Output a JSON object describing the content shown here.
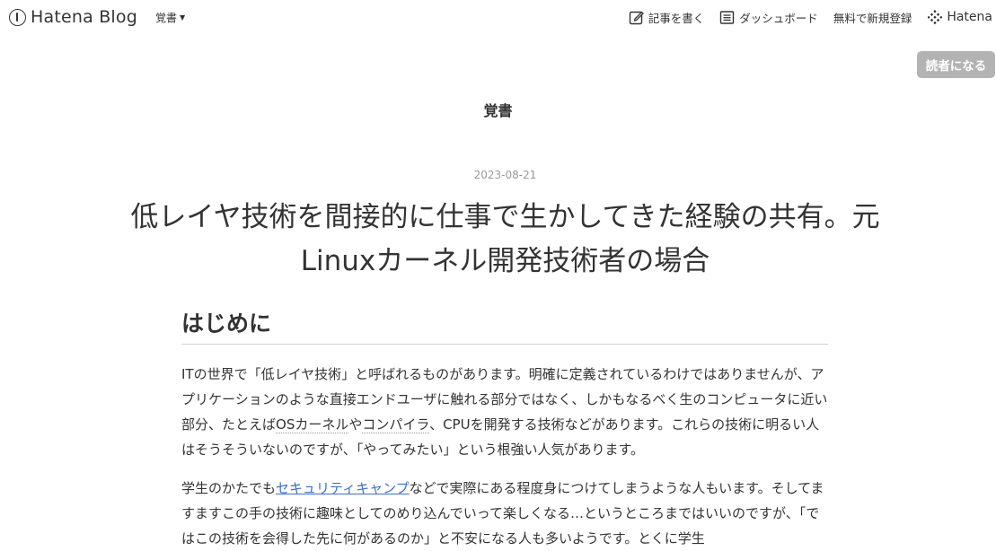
{
  "header": {
    "logo_text": "Hatena Blog",
    "blog_switch_label": "覚書",
    "write_label": "記事を書く",
    "dashboard_label": "ダッシュボード",
    "signup_label": "無料で新規登録",
    "hatena_label": "Hatena"
  },
  "subscribe_label": "読者になる",
  "blog": {
    "title": "覚書"
  },
  "entry": {
    "date": "2023-08-21",
    "title": "低レイヤ技術を間接的に仕事で生かしてきた経験の共有。元Linuxカーネル開発技術者の場合",
    "heading": "はじめに",
    "p1": {
      "t1": "ITの世界で「低レイヤ技術」と呼ばれるものがあります。明確に定義されているわけではありませんが、アプリケーションのような直接エンドユーザに触れる部分ではなく、しかもなるべく生のコンピュータに近い部分、たとえば",
      "kw1": "OSカーネル",
      "t2": "や",
      "kw2": "コンパイラ",
      "t3": "、CPUを開発する技術などがあります。これらの技術に明るい人はそうそういないのですが、「やってみたい」という根強い人気があります。"
    },
    "p2": {
      "t1": "学生のかたでも",
      "link": "セキュリティキャンプ",
      "t2": "などで実際にある程度身につけてしまうような人もいます。そしてますますこの手の技術に趣味としてのめり込んでいって楽しくなる…というところまではいいのですが、「ではこの技術を会得した先に何があるのか」と不安になる人も多いようです。とくに学生"
    }
  },
  "colors": {
    "text": "#333333",
    "date": "#999999",
    "link": "#3b6fd0",
    "subscribe_bg": "#b3b3b3"
  }
}
